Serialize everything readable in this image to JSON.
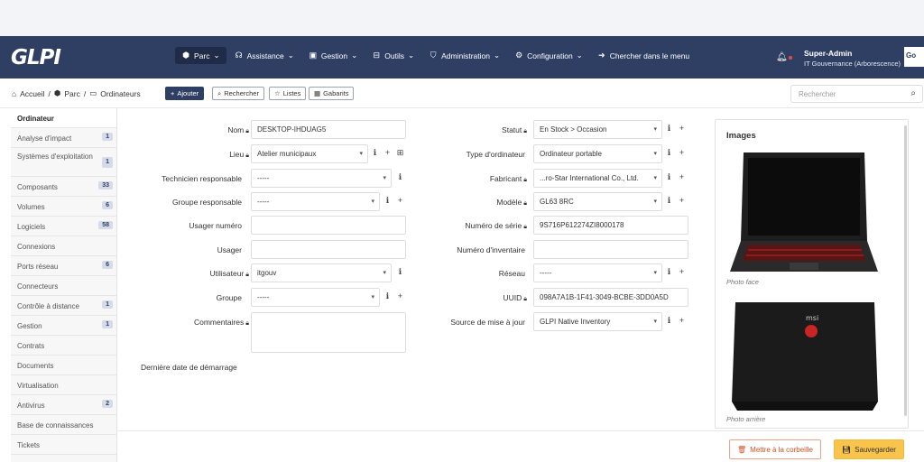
{
  "topnav": {
    "logo": "GLPI",
    "menu": [
      {
        "label": "Parc",
        "icon": "cube-icon"
      },
      {
        "label": "Assistance",
        "icon": "headset-icon"
      },
      {
        "label": "Gestion",
        "icon": "wallet-icon"
      },
      {
        "label": "Outils",
        "icon": "briefcase-icon"
      },
      {
        "label": "Administration",
        "icon": "shield-icon"
      },
      {
        "label": "Configuration",
        "icon": "gear-icon"
      },
      {
        "label": "Chercher dans le menu",
        "icon": "arrow-icon"
      }
    ],
    "user_name": "Super-Admin",
    "user_entity": "IT Gouvernance (Arborescence)",
    "avatar_text": "Go"
  },
  "breadcrumb": {
    "home": "Accueil",
    "parc": "Parc",
    "current": "Ordinateurs"
  },
  "toolbar": {
    "add": "Ajouter",
    "search": "Rechercher",
    "lists": "Listes",
    "templates": "Gabarits"
  },
  "search": {
    "placeholder": "Rechercher"
  },
  "sidebar": {
    "items": [
      {
        "label": "Ordinateur",
        "badge": ""
      },
      {
        "label": "Analyse d'impact",
        "badge": "1"
      },
      {
        "label": "Systèmes d'exploitation",
        "badge": "1"
      },
      {
        "label": "Composants",
        "badge": "33"
      },
      {
        "label": "Volumes",
        "badge": "6"
      },
      {
        "label": "Logiciels",
        "badge": "58"
      },
      {
        "label": "Connexions",
        "badge": ""
      },
      {
        "label": "Ports réseau",
        "badge": "6"
      },
      {
        "label": "Connecteurs",
        "badge": ""
      },
      {
        "label": "Contrôle à distance",
        "badge": "1"
      },
      {
        "label": "Gestion",
        "badge": "1"
      },
      {
        "label": "Contrats",
        "badge": ""
      },
      {
        "label": "Documents",
        "badge": ""
      },
      {
        "label": "Virtualisation",
        "badge": ""
      },
      {
        "label": "Antivirus",
        "badge": "2"
      },
      {
        "label": "Base de connaissances",
        "badge": ""
      },
      {
        "label": "Tickets",
        "badge": ""
      }
    ]
  },
  "form": {
    "nom_label": "Nom",
    "nom_value": "DESKTOP-IHDUAG5",
    "lieu_label": "Lieu",
    "lieu_value": "Atelier municipaux",
    "tech_label": "Technicien responsable",
    "tech_value": "-----",
    "groupe_resp_label": "Groupe responsable",
    "groupe_resp_value": "-----",
    "usager_num_label": "Usager numéro",
    "usager_num_value": "",
    "usager_label": "Usager",
    "usager_value": "",
    "utilisateur_label": "Utilisateur",
    "utilisateur_value": "itgouv",
    "groupe_label": "Groupe",
    "groupe_value": "-----",
    "commentaires_label": "Commentaires",
    "derniere_label": "Dernière date de démarrage",
    "statut_label": "Statut",
    "statut_value": "En Stock > Occasion",
    "type_label": "Type d'ordinateur",
    "type_value": "Ordinateur portable",
    "fabricant_label": "Fabricant",
    "fabricant_value": "...ro-Star International Co., Ltd.",
    "modele_label": "Modèle",
    "modele_value": "GL63 8RC",
    "serie_label": "Numéro de série",
    "serie_value": "9S716P612274ZI8000178",
    "inventaire_label": "Numéro d'inventaire",
    "inventaire_value": "",
    "reseau_label": "Réseau",
    "reseau_value": "-----",
    "uuid_label": "UUID",
    "uuid_value": "098A7A1B-1F41-3049-BCBE-3DD0A5D",
    "source_label": "Source de mise à jour",
    "source_value": "GLPI Native Inventory"
  },
  "images": {
    "title": "Images",
    "caption_front": "Photo face",
    "caption_back": "Photo arrière"
  },
  "footer": {
    "trash": "Mettre à la corbeille",
    "save": "Sauvegarder"
  },
  "colors": {
    "navbar": "#2f3f64",
    "save": "#f9c44c",
    "trash": "#d2501f"
  }
}
